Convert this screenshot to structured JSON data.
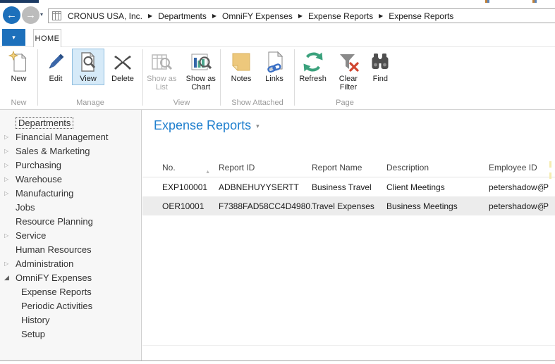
{
  "breadcrumb": {
    "company": "CRONUS USA, Inc.",
    "items": [
      "Departments",
      "OmniFY Expenses",
      "Expense Reports",
      "Expense Reports"
    ]
  },
  "ribbon": {
    "tab": "HOME",
    "groups": [
      {
        "name": "New",
        "buttons": [
          {
            "label": "New",
            "enabled": true
          }
        ]
      },
      {
        "name": "Manage",
        "buttons": [
          {
            "label": "Edit",
            "enabled": true
          },
          {
            "label": "View",
            "enabled": true,
            "selected": true
          },
          {
            "label": "Delete",
            "enabled": true
          }
        ]
      },
      {
        "name": "View",
        "buttons": [
          {
            "label": "Show as List",
            "enabled": false
          },
          {
            "label": "Show as Chart",
            "enabled": true
          }
        ]
      },
      {
        "name": "Show Attached",
        "buttons": [
          {
            "label": "Notes",
            "enabled": true
          },
          {
            "label": "Links",
            "enabled": true
          }
        ]
      },
      {
        "name": "Page",
        "buttons": [
          {
            "label": "Refresh",
            "enabled": true
          },
          {
            "label": "Clear Filter",
            "enabled": true
          },
          {
            "label": "Find",
            "enabled": true
          }
        ]
      }
    ]
  },
  "sidebar": {
    "items": [
      {
        "label": "Departments",
        "arrow": "none",
        "indent": 0,
        "focused": true
      },
      {
        "label": "Financial Management",
        "arrow": "collapsed",
        "indent": 0
      },
      {
        "label": "Sales & Marketing",
        "arrow": "collapsed",
        "indent": 0
      },
      {
        "label": "Purchasing",
        "arrow": "collapsed",
        "indent": 0
      },
      {
        "label": "Warehouse",
        "arrow": "collapsed",
        "indent": 0
      },
      {
        "label": "Manufacturing",
        "arrow": "collapsed",
        "indent": 0
      },
      {
        "label": "Jobs",
        "arrow": "none",
        "indent": 0
      },
      {
        "label": "Resource Planning",
        "arrow": "none",
        "indent": 0
      },
      {
        "label": "Service",
        "arrow": "collapsed",
        "indent": 0
      },
      {
        "label": "Human Resources",
        "arrow": "none",
        "indent": 0
      },
      {
        "label": "Administration",
        "arrow": "collapsed",
        "indent": 0
      },
      {
        "label": "OmniFY Expenses",
        "arrow": "expanded",
        "indent": 0
      },
      {
        "label": "Expense Reports",
        "arrow": "none",
        "indent": 1
      },
      {
        "label": "Periodic Activities",
        "arrow": "none",
        "indent": 1
      },
      {
        "label": "History",
        "arrow": "none",
        "indent": 1
      },
      {
        "label": "Setup",
        "arrow": "none",
        "indent": 1
      }
    ]
  },
  "main": {
    "title": "Expense Reports",
    "table": {
      "columns": [
        "No.",
        "Report ID",
        "Report Name",
        "Description",
        "Employee ID"
      ],
      "sort": {
        "column": "No.",
        "direction": "ascending"
      },
      "rows": [
        {
          "selected": false,
          "cells": [
            "EXP100001",
            "ADBNEHUYYSERTT",
            "Business Travel",
            "Client Meetings",
            "petershadow@c...",
            "P"
          ]
        },
        {
          "selected": true,
          "cells": [
            "OER10001",
            "F7388FAD58CC4D4980...",
            "Travel Expenses",
            "Business Meetings",
            "petershadow@c...",
            "P"
          ]
        }
      ]
    }
  },
  "colors": {
    "accent_blue": "#1d70bb",
    "title_blue": "#1f7fce",
    "selected_row": "#ececec",
    "note_yellow": "#edc87c",
    "refresh_green": "#3aa17c",
    "alert_red": "#d0452f"
  }
}
